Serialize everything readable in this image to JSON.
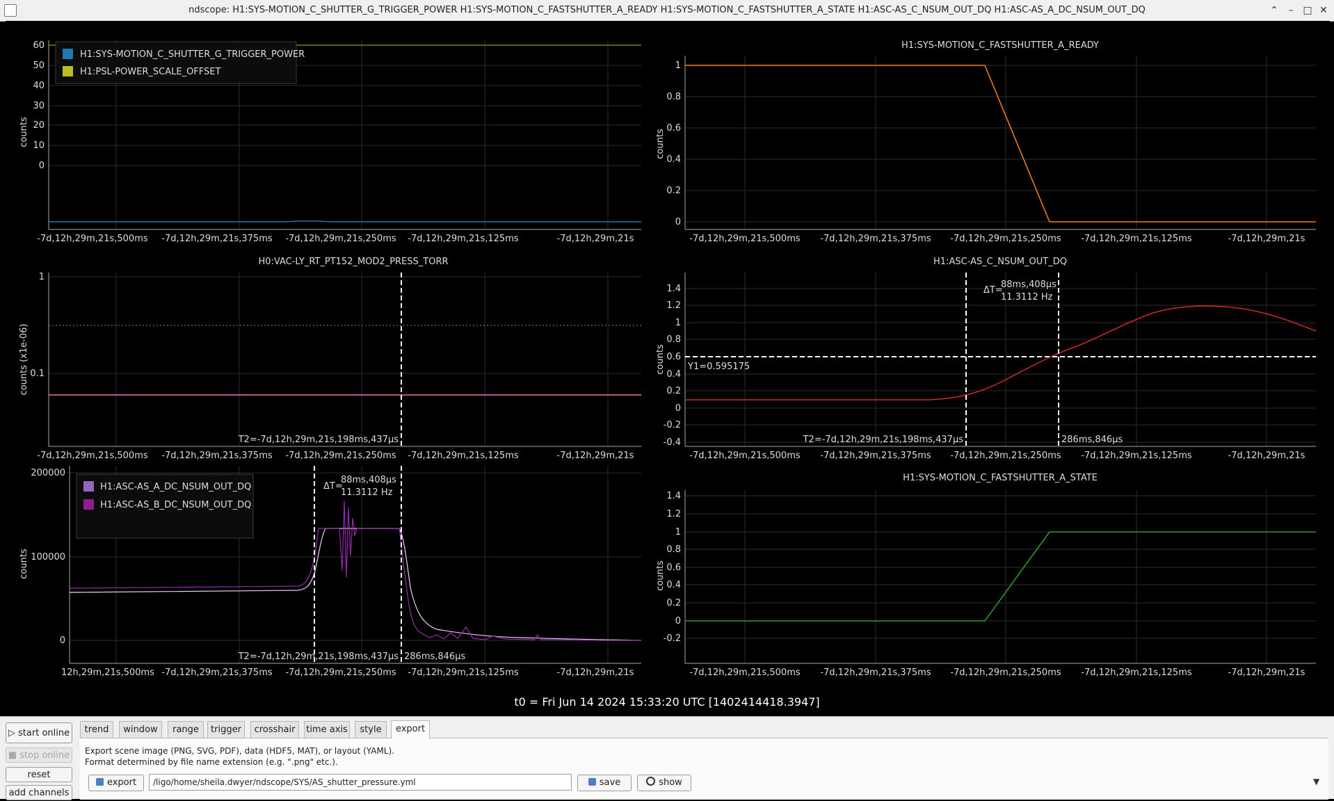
{
  "window": {
    "title": "ndscope: H1:SYS-MOTION_C_SHUTTER_G_TRIGGER_POWER H1:SYS-MOTION_C_FASTSHUTTER_A_READY H1:SYS-MOTION_C_FASTSHUTTER_A_STATE H1:ASC-AS_C_NSUM_OUT_DQ H1:ASC-AS_A_DC_NSUM_OUT_DQ"
  },
  "colors": {
    "blue": "#1f77b4",
    "olive": "#bcbd22",
    "orange": "#ff7f0e",
    "pink": "#e377c2",
    "red": "#d62728",
    "purple_light": "#9467bd",
    "purple_dark": "#8c1f8e",
    "green": "#2ca02c",
    "grid": "#2b2b2b",
    "cursor": "#ffffff"
  },
  "t0": "t0 = Fri Jun 14 2024 15:33:20 UTC [1402414418.3947]",
  "xticks": [
    "-7d,12h,29m,21s,500ms",
    "-7d,12h,29m,21s,375ms",
    "-7d,12h,29m,21s,250ms",
    "-7d,12h,29m,21s,125ms",
    "-7d,12h,29m,21s"
  ],
  "xticks_p5": [
    "12h,29m,21s,500ms",
    "-7d,12h,29m,21s,375ms",
    "-7d,12h,29m,21s,250ms",
    "-7d,12h,29m,21s,125ms",
    "-7d,12h,29m,21s"
  ],
  "plots": {
    "p1": {
      "title": "",
      "ylabel": "counts",
      "yticks": [
        "60",
        "50",
        "40",
        "30",
        "20",
        "10",
        "0"
      ],
      "legend": [
        "H1:SYS-MOTION_C_SHUTTER_G_TRIGGER_POWER",
        "H1:PSL-POWER_SCALE_OFFSET"
      ]
    },
    "p2": {
      "title": "H1:SYS-MOTION_C_FASTSHUTTER_A_READY",
      "ylabel": "counts",
      "yticks": [
        "1",
        "0.8",
        "0.6",
        "0.4",
        "0.2",
        "0"
      ]
    },
    "p3": {
      "title": "H0:VAC-LY_RT_PT152_MOD2_PRESS_TORR",
      "ylabel": "counts (x1e-06)",
      "yticks": [
        "1",
        "0.1"
      ],
      "t2_label": "T2=-7d,12h,29m,21s,198ms,437µs"
    },
    "p4": {
      "title": "H1:ASC-AS_C_NSUM_OUT_DQ",
      "ylabel": "counts",
      "yticks": [
        "1.4",
        "1.2",
        "1",
        "0.8",
        "0.6",
        "0.4",
        "0.2",
        "0",
        "-0.2",
        "-0.4"
      ],
      "delta_t": "ΔT=",
      "delta_val": "88ms,408µs",
      "delta_hz": "11.3112 Hz",
      "y1_label": "Y1=0.595175",
      "t2_label": "T2=-7d,12h,29m,21s,198ms,437µs",
      "t1_label": "286ms,846µs"
    },
    "p5": {
      "title": "",
      "ylabel": "counts",
      "yticks": [
        "200000",
        "100000",
        "0"
      ],
      "legend": [
        "H1:ASC-AS_A_DC_NSUM_OUT_DQ",
        "H1:ASC-AS_B_DC_NSUM_OUT_DQ"
      ],
      "delta_t": "ΔT=",
      "delta_val": "88ms,408µs",
      "delta_hz": "11.3112 Hz",
      "t2_label": "T2=-7d,12h,29m,21s,198ms,437µs",
      "t1_label": "286ms,846µs"
    },
    "p6": {
      "title": "H1:SYS-MOTION_C_FASTSHUTTER_A_STATE",
      "ylabel": "counts",
      "yticks": [
        "1.4",
        "1.2",
        "1",
        "0.8",
        "0.6",
        "0.4",
        "0.2",
        "0",
        "-0.2"
      ]
    }
  },
  "sidebar": {
    "start_online": "start online",
    "stop_online": "stop online",
    "reset": "reset",
    "add_channels": "add channels"
  },
  "tabs": [
    "trend",
    "window",
    "range",
    "trigger",
    "crosshair",
    "time axis",
    "style",
    "export"
  ],
  "export": {
    "desc1": "Export scene image (PNG, SVG, PDF), data (HDF5, MAT), or layout (YAML).",
    "desc2": "Format determined by file name extension (e.g. \".png\" etc.).",
    "export_label": "export",
    "path": "/ligo/home/sheila.dwyer/ndscope/SYS/AS_shutter_pressure.yml",
    "save_label": "save",
    "show_label": "show"
  }
}
